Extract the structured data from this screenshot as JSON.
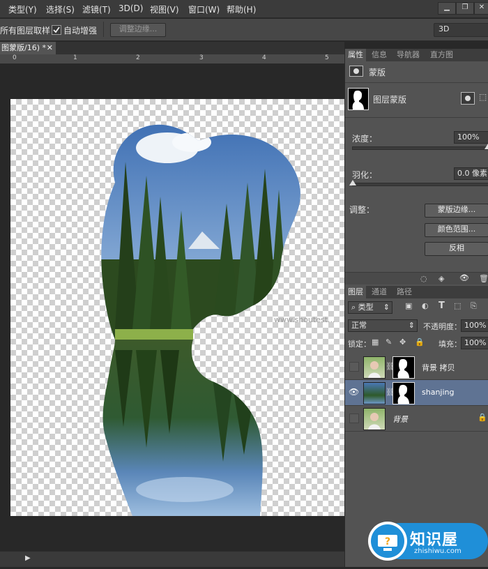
{
  "menu": {
    "items": [
      "类型(Y)",
      "选择(S)",
      "滤镜(T)",
      "3D(D)",
      "视图(V)",
      "窗口(W)",
      "帮助(H)"
    ]
  },
  "options": {
    "sample_all_layers": "所有图层取样",
    "auto_enhance": "自动增强",
    "refine_edge": "调整边缘...",
    "workspace": "3D"
  },
  "document": {
    "tab_title": "图蒙版/16) *",
    "ruler_ticks": [
      "0",
      "1",
      "2",
      "3",
      "4",
      "5"
    ],
    "watermark": "www.shoutest..."
  },
  "properties": {
    "tabs": [
      "属性",
      "信息",
      "导航器",
      "直方图"
    ],
    "header": "蒙版",
    "mask_type": "图层蒙版",
    "density_label": "浓度：",
    "density_value": "100%",
    "feather_label": "羽化：",
    "feather_value": "0.0 像素",
    "adjust_label": "调整：",
    "btn_mask_edge": "蒙版边缘...",
    "btn_color_range": "颜色范围...",
    "btn_invert": "反相",
    "density": 1.0,
    "feather": 0.0
  },
  "layers": {
    "tabs": [
      "图层",
      "通道",
      "路径"
    ],
    "filter_kind": "类型",
    "blend_mode": "正常",
    "opacity_label": "不透明度：",
    "opacity_value": "100%",
    "lock_label": "锁定：",
    "fill_label": "填充：",
    "fill_value": "100%",
    "items": [
      {
        "name": "背景 拷贝",
        "visible": false,
        "selected": false
      },
      {
        "name": "shanjing",
        "visible": true,
        "selected": true
      },
      {
        "name": "背景",
        "visible": false,
        "selected": false,
        "locked": true
      }
    ]
  },
  "badge": {
    "title": "知识屋",
    "url": "zhishiwu.com"
  },
  "colors": {
    "selection": "#5f7393",
    "panel": "#535353",
    "badge_blue": "#1f8fd8"
  }
}
